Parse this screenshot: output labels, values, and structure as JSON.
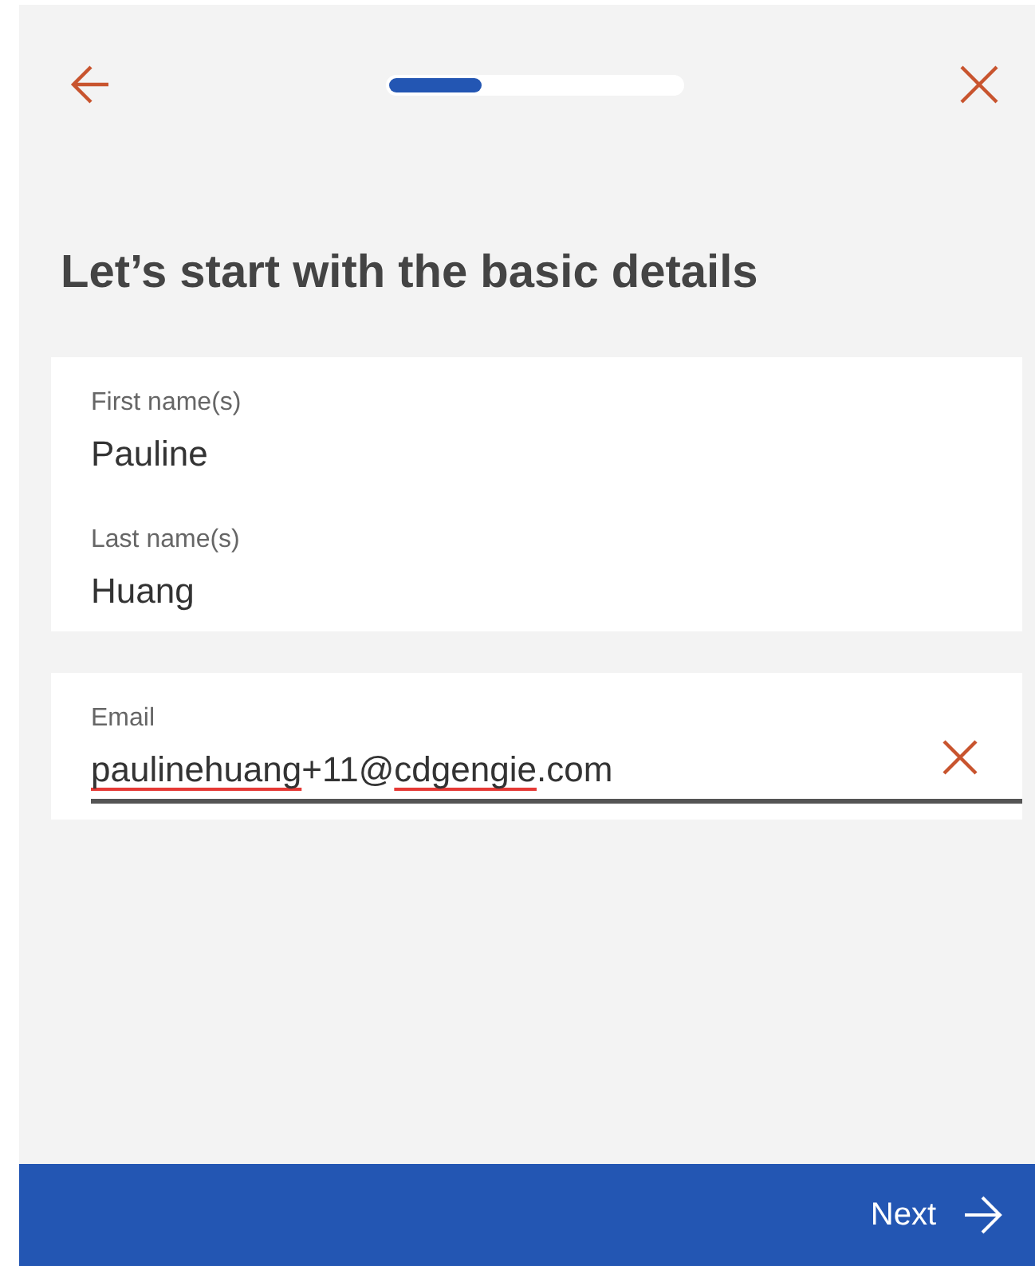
{
  "header": {
    "progress": {
      "level": 0.31
    }
  },
  "title": "Let’s start with the basic details",
  "cards": [
    {
      "fields": [
        {
          "label": "First name(s)",
          "value_parts": [
            {
              "text": "Pauline",
              "misspelled": false
            }
          ],
          "focused": false,
          "clearable": false
        },
        {
          "label": "Last name(s)",
          "value_parts": [
            {
              "text": "Huang",
              "misspelled": false
            }
          ],
          "focused": false,
          "clearable": false
        }
      ]
    },
    {
      "fields": [
        {
          "label": "Email",
          "value_parts": [
            {
              "text": "paulinehuang",
              "misspelled": true
            },
            {
              "text": "+11@",
              "misspelled": false
            },
            {
              "text": "cdgengie",
              "misspelled": true
            },
            {
              "text": ".com",
              "misspelled": false
            }
          ],
          "focused": true,
          "clearable": true
        }
      ]
    }
  ],
  "footer": {
    "button": "Next"
  }
}
